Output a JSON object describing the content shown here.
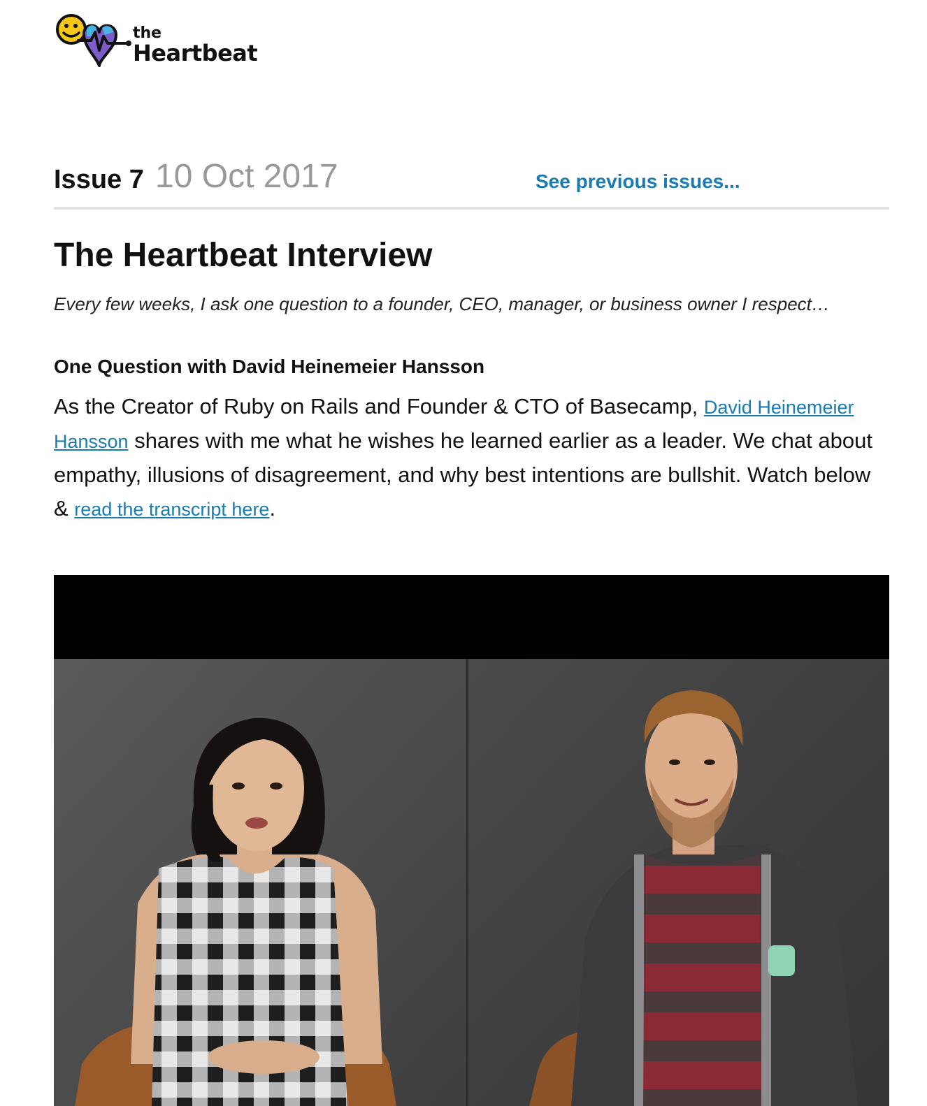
{
  "logo": {
    "the": "the",
    "name": "Heartbeat"
  },
  "issue": {
    "label": "Issue 7",
    "date": "10 Oct 2017",
    "previous_link": "See previous issues..."
  },
  "section": {
    "title": "The Heartbeat Interview",
    "intro": "Every few weeks, I ask one question to a founder, CEO, manager, or business owner I respect…"
  },
  "article": {
    "subtitle": "One Question with David Heinemeier Hansson",
    "text_1": "As the Creator of Ruby on Rails and Founder & CTO of Basecamp, ",
    "link_1": "David Heinemeier Hansson",
    "text_2": " shares with me what he wishes he learned earlier as a leader. We chat about empathy, illusions of disagreement, and why best intentions are bullshit. Watch below & ",
    "link_2": "read the transcript here",
    "text_3": "."
  },
  "colors": {
    "link": "#1a7bb0",
    "date_gray": "#999999",
    "divider": "#e3e3e3",
    "logo_yellow": "#f5c518",
    "logo_purple": "#7b5cc9",
    "logo_blue": "#4ab3e6"
  },
  "icons": {
    "logo": "smiley-heart-heartbeat-logo",
    "video": "video-thumbnail"
  }
}
